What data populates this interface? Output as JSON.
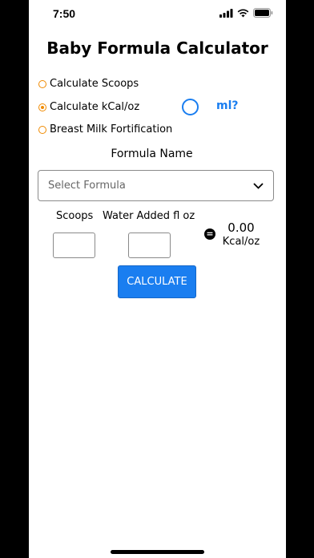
{
  "status_bar": {
    "time": "7:50",
    "icons": [
      "signal-icon",
      "wifi-icon",
      "battery-icon"
    ]
  },
  "app": {
    "title": "Baby Formula Calculator"
  },
  "modes": {
    "options": [
      {
        "label": "Calculate Scoops",
        "checked": false
      },
      {
        "label": "Calculate kCal/oz",
        "checked": true
      },
      {
        "label": "Breast Milk Fortification",
        "checked": false
      }
    ],
    "unit_toggle_label": "ml?"
  },
  "formula": {
    "label": "Formula Name",
    "placeholder": "Select Formula"
  },
  "inputs": {
    "scoops_label": "Scoops",
    "water_label": "Water Added fl oz",
    "scoops_value": "",
    "water_value": ""
  },
  "result": {
    "equals_symbol": "=",
    "value": "0.00",
    "unit": "Kcal/oz"
  },
  "actions": {
    "calculate_label": "CALCULATE"
  },
  "colors": {
    "accent_orange": "#f08a00",
    "accent_blue": "#1a7ef0"
  }
}
